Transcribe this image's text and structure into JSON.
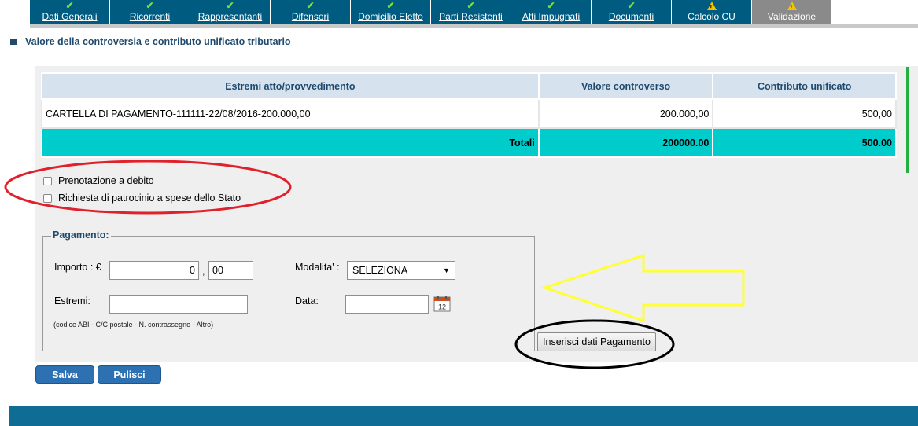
{
  "tabs": [
    {
      "label": "Dati Generali",
      "status": "check"
    },
    {
      "label": "Ricorrenti",
      "status": "check"
    },
    {
      "label": "Rappresentanti",
      "status": "check"
    },
    {
      "label": "Difensori",
      "status": "check"
    },
    {
      "label": "Domicilio Eletto",
      "status": "check"
    },
    {
      "label": "Parti Resistenti",
      "status": "check"
    },
    {
      "label": "Atti Impugnati",
      "status": "check"
    },
    {
      "label": "Documenti",
      "status": "check"
    },
    {
      "label": "Calcolo CU",
      "status": "warning"
    },
    {
      "label": "Validazione",
      "status": "warning"
    }
  ],
  "section_title": "Valore della controversia e contributo unificato tributario",
  "table": {
    "headers": [
      "Estremi atto/provvedimento",
      "Valore controverso",
      "Contributo unificato"
    ],
    "rows": [
      {
        "estremi": "CARTELLA DI PAGAMENTO-111111-22/08/2016-200.000,00",
        "valore": "200.000,00",
        "contributo": "500,00"
      }
    ],
    "totals": {
      "label": "Totali",
      "valore": "200000.00",
      "contributo": "500.00"
    }
  },
  "checkboxes": {
    "prenotazione": "Prenotazione a debito",
    "patrocinio": "Richiesta di patrocinio a spese dello Stato"
  },
  "pagamento": {
    "legend": "Pagamento:",
    "importo_label": "Importo : €",
    "importo_int": "0",
    "comma": ",",
    "importo_dec": "00",
    "modalita_label": "Modalita' :",
    "modalita_value": "SELEZIONA",
    "estremi_label": "Estremi:",
    "estremi_value": "",
    "data_label": "Data:",
    "data_value": "",
    "hint": "(codice ABI - C/C postale - N. contrassegno - Altro)",
    "calendar_day": "12",
    "insert_button": "Inserisci dati Pagamento"
  },
  "buttons": {
    "save": "Salva",
    "clear": "Pulisci"
  },
  "colors": {
    "tab_bg": "#005b80",
    "tab_active": "#8a8a8a",
    "totals_bg": "#00cccc",
    "button_blue": "#2d71b3",
    "annotation_red": "#e0202a",
    "annotation_yellow": "#ffff33"
  }
}
